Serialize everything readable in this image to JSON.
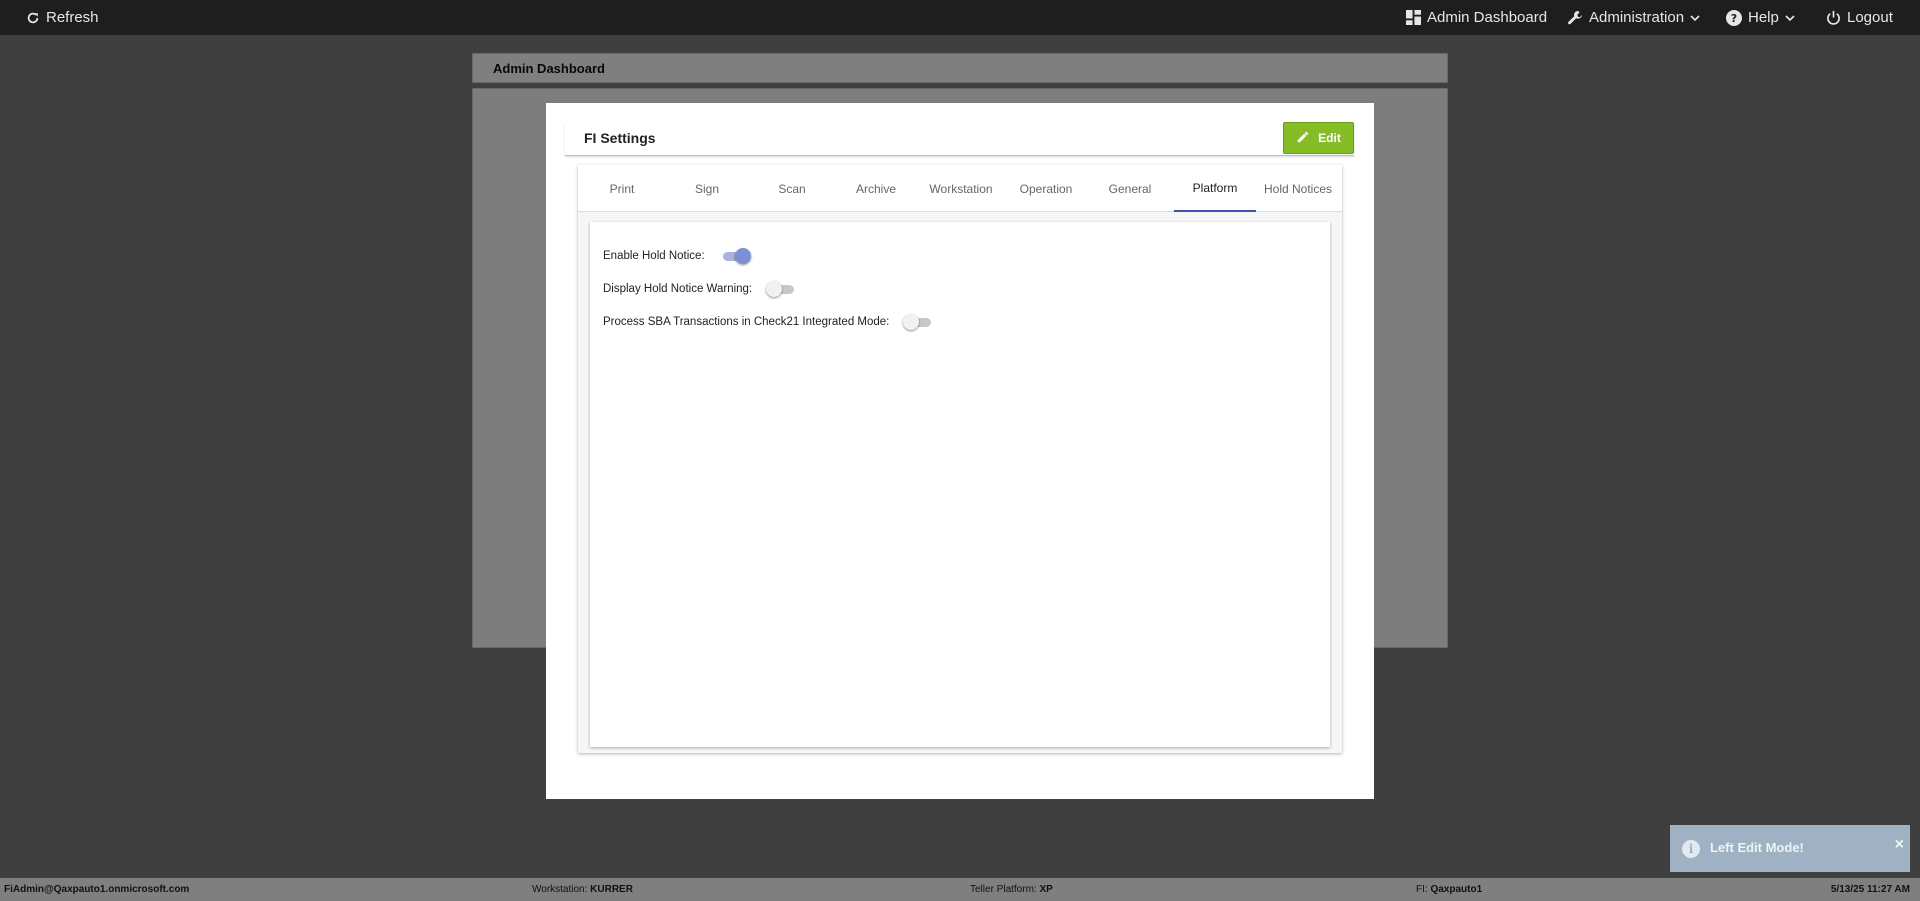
{
  "topbar": {
    "refresh_label": "Refresh",
    "admin_dashboard_label": "Admin Dashboard",
    "administration_label": "Administration",
    "help_label": "Help",
    "logout_label": "Logout"
  },
  "page": {
    "title": "Admin Dashboard"
  },
  "modal": {
    "title": "FI Settings",
    "edit_label": "Edit",
    "tabs": [
      {
        "label": "Print"
      },
      {
        "label": "Sign"
      },
      {
        "label": "Scan"
      },
      {
        "label": "Archive"
      },
      {
        "label": "Workstation"
      },
      {
        "label": "Operation"
      },
      {
        "label": "General"
      },
      {
        "label": "Platform"
      },
      {
        "label": "Hold Notices"
      }
    ],
    "active_tab": "Platform",
    "settings": [
      {
        "label": "Enable Hold Notice:",
        "enabled": true
      },
      {
        "label": "Display Hold Notice Warning:",
        "enabled": false
      },
      {
        "label": "Process SBA Transactions in Check21 Integrated Mode:",
        "enabled": false
      }
    ]
  },
  "toast": {
    "message": "Left Edit Mode!",
    "close_glyph": "×",
    "icon": "info-icon"
  },
  "statusbar": {
    "user": "FiAdmin@Qaxpauto1.onmicrosoft.com",
    "workstation_label": "Workstation:",
    "workstation_value": "KURRER",
    "platform_label": "Teller Platform:",
    "platform_value": "XP",
    "fi_label": "FI:",
    "fi_value": "Qaxpauto1",
    "datetime": "5/13/25 11:27 AM"
  },
  "colors": {
    "topbar": "#1e1e1e",
    "edit_button": "#86bc25",
    "active_tab_underline": "#3f51b5",
    "toggle_on": "#7f8fd6",
    "toast": "#9fb1c2"
  }
}
